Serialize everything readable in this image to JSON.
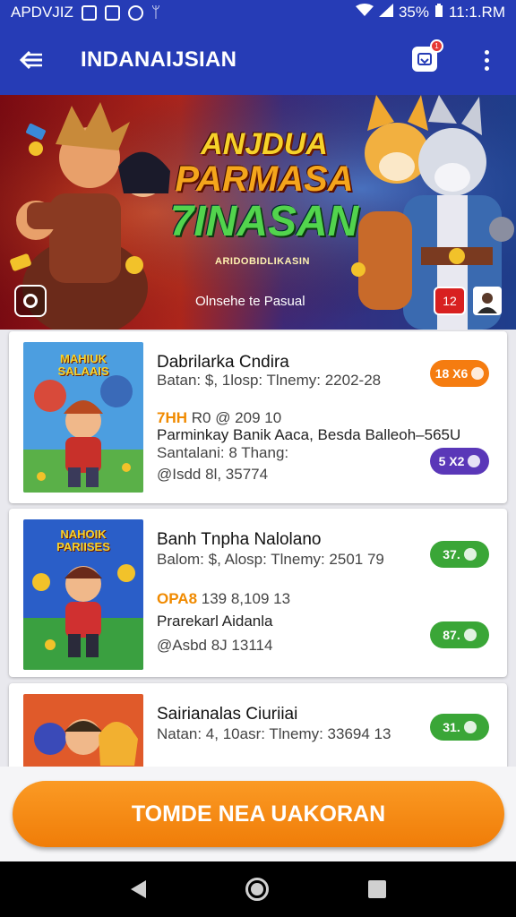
{
  "status_bar": {
    "left_text": "APDVJIZ",
    "right_text": "35%",
    "time": "11:1.RM"
  },
  "app_bar": {
    "title": "INDANAIJSIAN",
    "notification_badge": "1"
  },
  "banner": {
    "title_lines": [
      "ANJDUA",
      "PARMASA",
      "7INASAN"
    ],
    "subtitle": "ARIDOBIDLIKASIN",
    "caption": "Olnsehe te Pasual",
    "badge_number": "12"
  },
  "cards": [
    {
      "thumb_text": "MAHIUK SALAAIS",
      "title": "Dabrilarka Cndira",
      "meta": "Batan: $, 1losp: Tlnemy: 2202-28",
      "highlight": "7HH",
      "highlight_rest": " R0 @ 209 10",
      "description_1": "Parminkay Banik Aaca, Besda Balleoh–565U",
      "description_2": "Santalani: 8 Thang:",
      "stats": "@Isdd 8l, 35774",
      "pill_top": "18 X6",
      "pill_bottom": "5 X2",
      "pill_top_color": "#f57c10",
      "pill_bottom_color": "#5a37b8"
    },
    {
      "thumb_text": "NAHOIK PARIISES",
      "title": "Banh Tnpha Nalolano",
      "meta": "Balom: $, Alosp: Tlnemy: 2501 79",
      "highlight": "OPA8",
      "highlight_rest": " 139 8,109 13",
      "description_1": "Prarekarl Aidanla",
      "stats": "@Asbd 8J 13114",
      "pill_top": "37.",
      "pill_bottom": "87.",
      "pill_top_color": "#3aa637",
      "pill_bottom_color": "#3aa637"
    },
    {
      "title": "Sairianalas Ciuriiai",
      "meta": "Natan: 4, 10asr: Tlnemy: 33694 13",
      "pill_top": "31.",
      "pill_top_color": "#3aa637"
    }
  ],
  "cta": {
    "label": "TOMDE NEA UAKORAN"
  },
  "colors": {
    "primary": "#263cb6",
    "accent": "#f08a00",
    "success": "#3aa637"
  },
  "icons": [
    "back-arrow-icon",
    "notification-icon",
    "more-vert-icon",
    "nav-back-icon",
    "nav-home-icon",
    "nav-recents-icon"
  ]
}
